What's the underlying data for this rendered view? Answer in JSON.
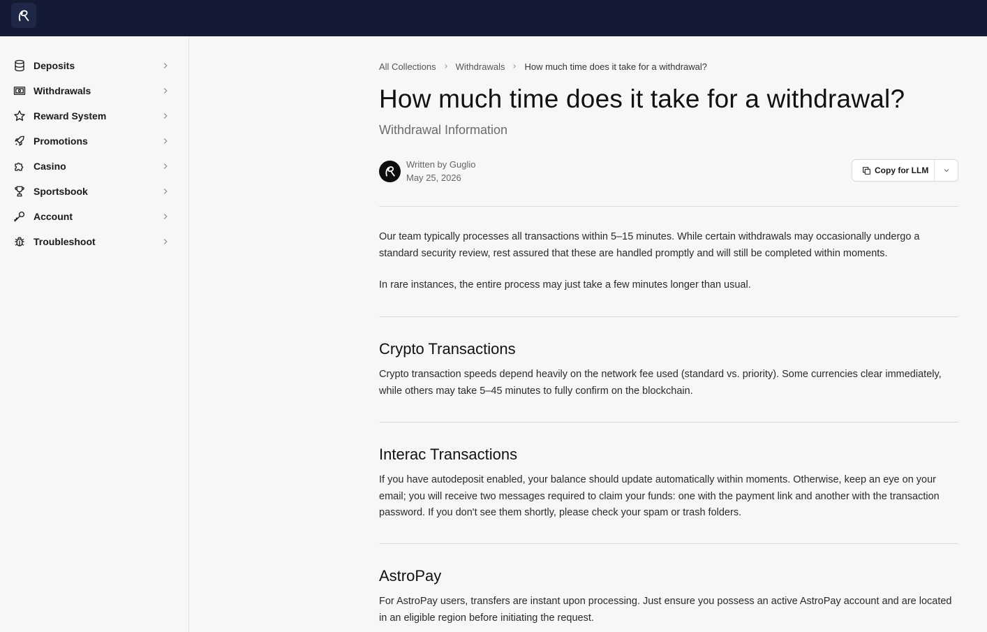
{
  "app": {
    "brand_colors": {
      "topbar": "#141a33",
      "background": "#f7f7f7"
    },
    "logo_icon": "brand-logo-icon"
  },
  "sidebar": {
    "items": [
      {
        "label": "Deposits",
        "icon": "database-icon"
      },
      {
        "label": "Withdrawals",
        "icon": "banknote-icon"
      },
      {
        "label": "Reward System",
        "icon": "star-icon"
      },
      {
        "label": "Promotions",
        "icon": "rocket-icon"
      },
      {
        "label": "Casino",
        "icon": "puzzle-icon"
      },
      {
        "label": "Sportsbook",
        "icon": "trophy-icon"
      },
      {
        "label": "Account",
        "icon": "key-icon"
      },
      {
        "label": "Troubleshoot",
        "icon": "bug-icon"
      }
    ]
  },
  "breadcrumb": {
    "items": [
      "All Collections",
      "Withdrawals"
    ],
    "current": "How much time does it take for a withdrawal?"
  },
  "article": {
    "title": "How much time does it take for a withdrawal?",
    "subtitle": "Withdrawal Information",
    "author_line": "Written by Guglio",
    "date": "May 25, 2026",
    "copy_button": "Copy for LLM",
    "intro_1": "Our team typically processes all transactions within 5–15 minutes. While certain withdrawals may occasionally undergo a standard security review, rest assured that these are handled promptly and will still be completed within moments.",
    "intro_2": "In rare instances, the entire process may just take a few minutes longer than usual.",
    "sections": [
      {
        "heading": "Crypto Transactions",
        "body": "Crypto transaction speeds depend heavily on the network fee used (standard vs. priority). Some currencies clear immediately, while others may take 5–45 minutes to fully confirm on the blockchain."
      },
      {
        "heading": "Interac Transactions",
        "body": "If you have autodeposit enabled, your balance should update automatically within moments. Otherwise, keep an eye on your email; you will receive two messages required to claim your funds: one with the payment link and another with the transaction password. If you don't see them shortly, please check your spam or trash folders."
      },
      {
        "heading": "AstroPay",
        "body": "For AstroPay users, transfers are instant upon processing. Just ensure you possess an active AstroPay account and are located in an eligible region before initiating the request."
      }
    ]
  }
}
